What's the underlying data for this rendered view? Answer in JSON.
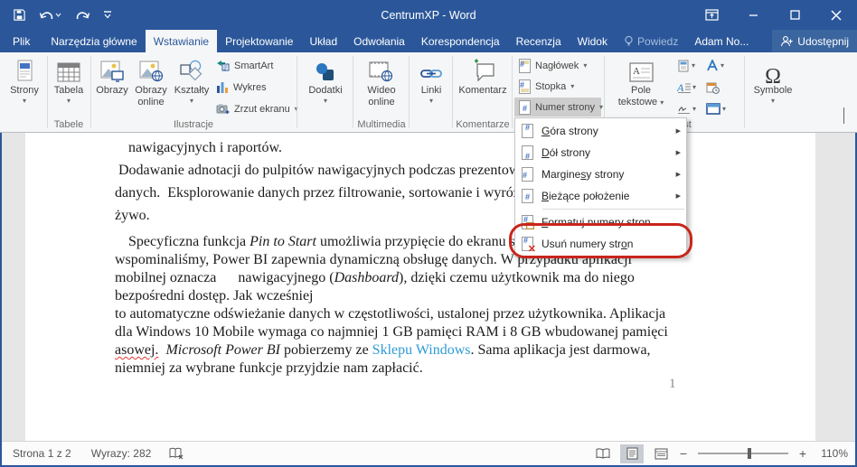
{
  "titlebar": {
    "title": "CentrumXP - Word"
  },
  "tabs": {
    "file": "Plik",
    "main": [
      "Narzędzia główne",
      "Wstawianie",
      "Projektowanie",
      "Układ",
      "Odwołania",
      "Korespondencja",
      "Recenzja",
      "Widok"
    ],
    "active": "Wstawianie",
    "tell_me": "Powiedz",
    "account": "Adam No...",
    "share": "Udostępnij"
  },
  "ribbon": {
    "strony": "Strony",
    "tabela": "Tabela",
    "group_tabele": "Tabele",
    "obrazy": "Obrazy",
    "obrazy_online_1": "Obrazy",
    "obrazy_online_2": "online",
    "ksztalty": "Kształty",
    "smartart": "SmartArt",
    "wykres": "Wykres",
    "zrzut_ekranu": "Zrzut ekranu",
    "group_ilustracje": "Ilustracje",
    "dodatki": "Dodatki",
    "wideo_1": "Wideo",
    "wideo_2": "online",
    "group_multimedia": "Multimedia",
    "linki": "Linki",
    "komentarz": "Komentarz",
    "group_komentarze": "Komentarze",
    "naglowek": "Nagłówek",
    "stopka": "Stopka",
    "numer_strony": "Numer strony",
    "pole_1": "Pole",
    "pole_2": "tekstowe",
    "group_tekst": "Tekst",
    "symbole": "Symbole",
    "omega": "Ω"
  },
  "menu": {
    "items": [
      {
        "pre": "",
        "accel": "G",
        "post": "óra strony",
        "submenu": true
      },
      {
        "pre": "",
        "accel": "D",
        "post": "ół strony",
        "submenu": true
      },
      {
        "pre": "Margine",
        "accel": "s",
        "post": "y strony",
        "submenu": true
      },
      {
        "pre": "",
        "accel": "B",
        "post": "ieżące położenie",
        "submenu": true
      },
      {
        "pre": "",
        "accel": "F",
        "post": "ormatuj numery stron...",
        "submenu": false
      },
      {
        "pre": "Usuń numery str",
        "accel": "o",
        "post": "n",
        "submenu": false
      }
    ]
  },
  "document": {
    "para1": [
      {
        "indent": true,
        "segs": [
          {
            "t": "nawigacyjnych i raportów."
          }
        ]
      },
      {
        "segs": [
          {
            "t": " Dodawanie adnotacji do pulpitów nawigacyjnych podczas prezentowa"
          }
        ]
      },
      {
        "segs": [
          {
            "t": "danych.  Eksplorowanie danych przez filtrowanie, sortowanie i wyróżn"
          }
        ]
      },
      {
        "segs": [
          {
            "t": "żywo."
          }
        ]
      }
    ],
    "para2": [
      {
        "indent": true,
        "segs": [
          {
            "t": "Specyficzna funkcja "
          },
          {
            "t": "Pin to Start",
            "s": "i"
          },
          {
            "t": " umożliwia przypięcie do ekranu sta"
          }
        ]
      },
      {
        "segs": [
          {
            "t": "wspominaliśmy, Power BI zapewnia dynamiczną obsługę danych. W przypadku aplikacji"
          }
        ]
      },
      {
        "segs": [
          {
            "t": "mobilnej oznacza      nawigacyjnego ("
          },
          {
            "t": "Dashboard",
            "s": "i"
          },
          {
            "t": "), dzięki czemu użytkownik ma do niego"
          }
        ]
      },
      {
        "segs": [
          {
            "t": "bezpośredni dostęp. Jak wcześniej"
          }
        ]
      },
      {
        "segs": [
          {
            "t": "to automatyczne odświeżanie danych w częstotliwości, ustalonej przez użytkownika. Aplikacja"
          }
        ]
      },
      {
        "segs": [
          {
            "t": "dla Windows 10 Mobile wymaga co najmniej 1 GB pamięci RAM i 8 GB wbudowanej pamięci"
          }
        ]
      },
      {
        "segs": [
          {
            "t": "asowej.",
            "s": "sq"
          },
          {
            "t": "  "
          },
          {
            "t": "Microsoft Power BI",
            "s": "i"
          },
          {
            "t": " pobierzemy ze "
          },
          {
            "t": "Sklepu Windows",
            "s": "link"
          },
          {
            "t": ". Sama aplikacja jest darmowa,"
          }
        ]
      },
      {
        "segs": [
          {
            "t": "niemniej za wybrane funkcje przyjdzie nam zapłacić."
          }
        ]
      }
    ],
    "page_number": "1"
  },
  "status": {
    "page": "Strona 1 z 2",
    "words": "Wyrazy: 282",
    "zoom_level": "110%"
  },
  "colors": {
    "brand": "#2b579a",
    "link": "#2e9bd6",
    "annotation": "#c9251c",
    "spellcheck": "#e53935"
  }
}
